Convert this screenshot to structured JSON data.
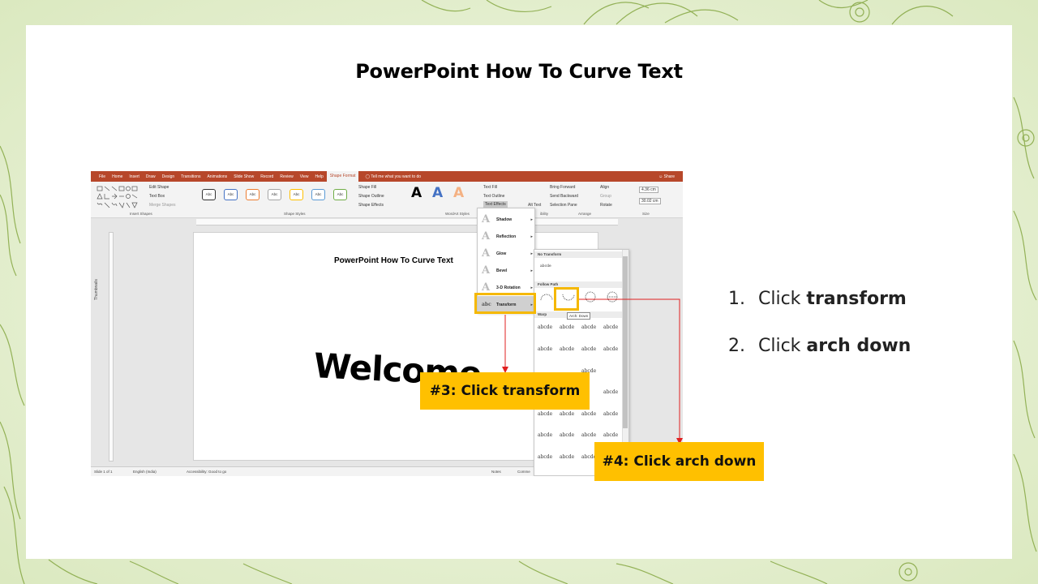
{
  "slide": {
    "title": "PowerPoint How To Curve Text",
    "steps": [
      {
        "num": "1.",
        "prefix": "Click ",
        "bold": "transform"
      },
      {
        "num": "2.",
        "prefix": "Click ",
        "bold": "arch down"
      }
    ]
  },
  "callouts": {
    "step3": "#3: Click transform",
    "step4": "#4: Click arch down"
  },
  "colors": {
    "accent": "#ffc000",
    "highlight_border": "#f5b800",
    "arrow": "#e02020",
    "ribbon": "#b7472a"
  },
  "screenshot": {
    "tabs": [
      "File",
      "Home",
      "Insert",
      "Draw",
      "Design",
      "Transitions",
      "Animations",
      "Slide Show",
      "Record",
      "Review",
      "View",
      "Help",
      "Shape Format"
    ],
    "tell_me": "Tell me what you want to do",
    "share": "Share",
    "ribbon": {
      "edit_shape": "Edit Shape",
      "text_box": "Text Box",
      "merge_shapes": "Merge Shapes",
      "insert_shapes_label": "Insert Shapes",
      "style_sample": "Abc",
      "shape_fill": "Shape Fill",
      "shape_outline": "Shape Outline",
      "shape_effects": "Shape Effects",
      "shape_styles_label": "Shape Styles",
      "wordart_letter": "A",
      "text_fill": "Text Fill",
      "text_outline": "Text Outline",
      "text_effects": "Text Effects",
      "wordart_label": "WordArt Styles",
      "alt_text": "Alt Text",
      "accessibility": "ibility",
      "bring_forward": "Bring Forward",
      "send_backward": "Send Backward",
      "selection_pane": "Selection Pane",
      "align": "Align",
      "group": "Group",
      "rotate": "Rotate",
      "arrange_label": "Arrange",
      "height": "4.36 cm",
      "width": "30.02 cm",
      "size_label": "Size"
    },
    "thumbnails_label": "Thumbnails",
    "inner_title": "PowerPoint How To Curve Text",
    "welcome": "Welcome",
    "effects_menu": [
      {
        "label": "Shadow",
        "icon": "A"
      },
      {
        "label": "Reflection",
        "icon": "A"
      },
      {
        "label": "Glow",
        "icon": "A"
      },
      {
        "label": "Bevel",
        "icon": "A"
      },
      {
        "label": "3-D Rotation",
        "icon": "A"
      },
      {
        "label": "Transform",
        "icon": "abc"
      }
    ],
    "transform_panel": {
      "no_transform": "No Transform",
      "plain_sample": "abcde",
      "follow_path": "Follow Path",
      "warp": "Warp",
      "warp_sample": "abcde",
      "tooltip": "Arch: Down"
    },
    "status": {
      "slide": "Slide 1 of 1",
      "language": "English (India)",
      "accessibility": "Accessibility: Good to go",
      "notes": "Notes",
      "comments": "Comme"
    }
  }
}
